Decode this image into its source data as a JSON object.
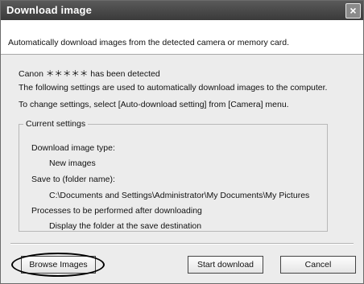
{
  "window": {
    "title": "Download image",
    "close_glyph": "×"
  },
  "header": {
    "text": "Automatically download images from the detected camera or memory card."
  },
  "body": {
    "detected": "Canon ＊＊＊＊＊ has been detected",
    "info": "The following settings are used to automatically download images to the computer.",
    "change": "To change settings, select [Auto-download setting] from [Camera] menu."
  },
  "current_settings": {
    "legend": "Current settings",
    "type_label": "Download image type:",
    "type_value": "New images",
    "save_label": "Save to (folder name):",
    "save_value": "C:\\Documents and Settings\\Administrator\\My Documents\\My Pictures",
    "process_label": "Processes to be performed after downloading",
    "process_value": "Display the folder at the save destination"
  },
  "buttons": {
    "browse": "Browse Images",
    "start": "Start download",
    "cancel": "Cancel"
  }
}
